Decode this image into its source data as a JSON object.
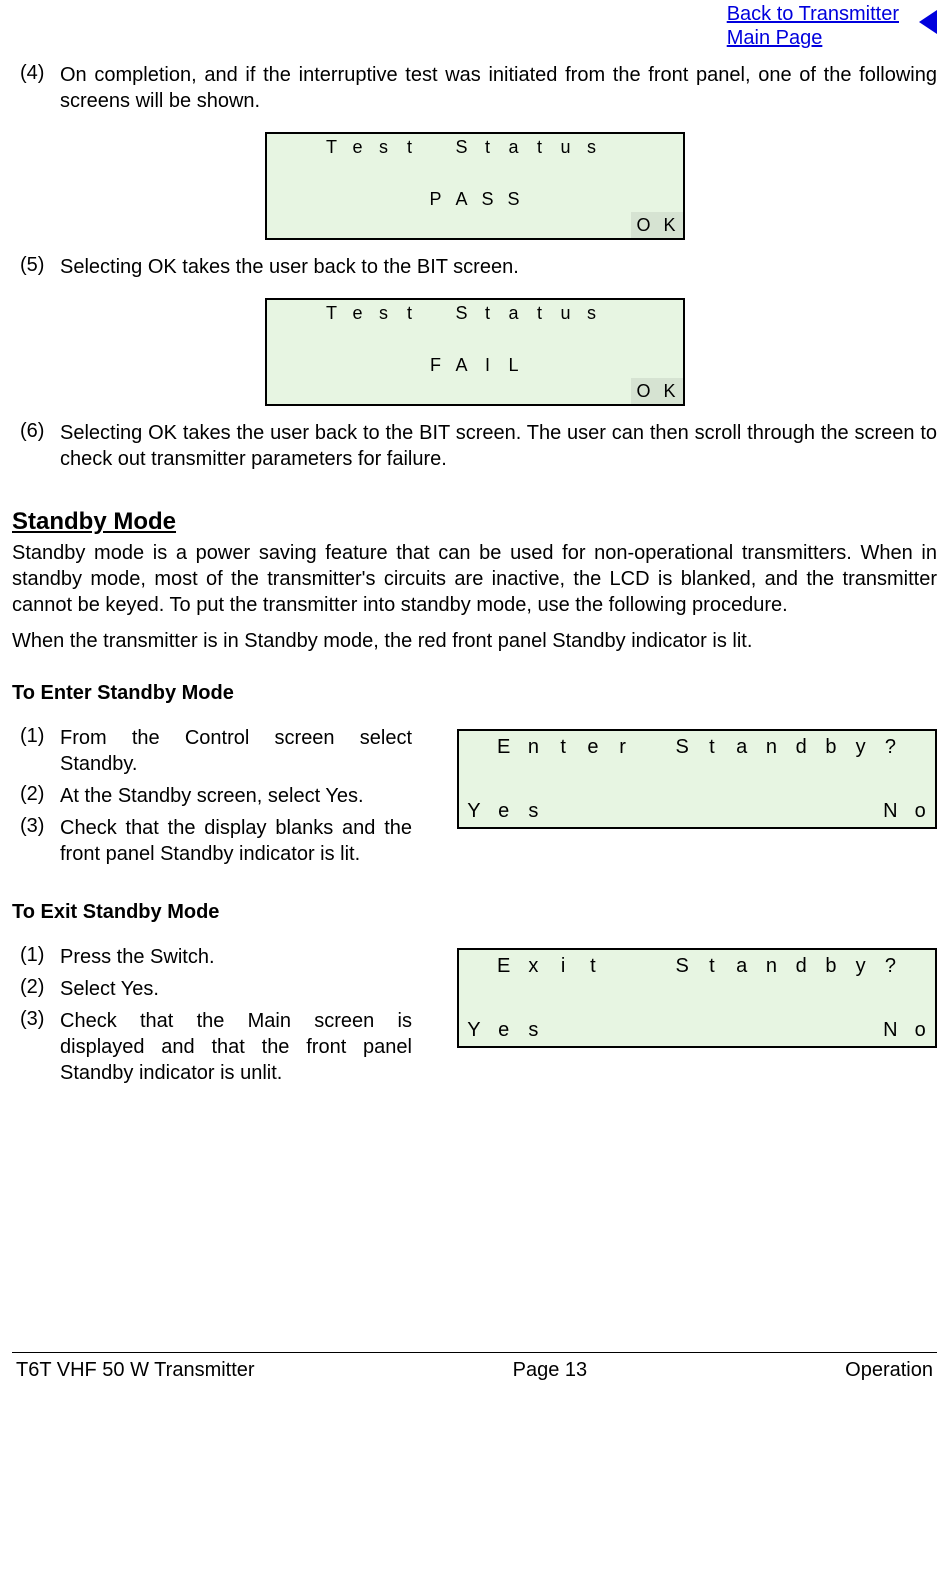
{
  "nav": {
    "back_link": "Back to Transmitter\nMain Page"
  },
  "steps_top": [
    {
      "num": "(4)",
      "text": "On completion, and if the interruptive test was initiated from the front panel, one of the following screens will be shown."
    },
    {
      "num": "(5)",
      "text": "Selecting OK takes the user back to the BIT screen."
    },
    {
      "num": "(6)",
      "text": "Selecting OK takes the user back to the BIT screen. The user can then scroll through the screen to check out transmitter parameters for failure."
    }
  ],
  "lcd_pass": {
    "r1": [
      "",
      "",
      "T",
      "e",
      "s",
      "t",
      "",
      "S",
      "t",
      "a",
      "t",
      "u",
      "s",
      "",
      "",
      ""
    ],
    "r2": [
      "",
      "",
      "",
      "",
      "",
      "",
      "",
      "",
      "",
      "",
      "",
      "",
      "",
      "",
      "",
      ""
    ],
    "r3": [
      "",
      "",
      "",
      "",
      "",
      "",
      "P",
      "A",
      "S",
      "S",
      "",
      "",
      "",
      "",
      "",
      ""
    ],
    "r4": [
      "",
      "",
      "",
      "",
      "",
      "",
      "",
      "",
      "",
      "",
      "",
      "",
      "",
      "",
      "O",
      "K"
    ],
    "hl": [
      14,
      15
    ]
  },
  "lcd_fail": {
    "r1": [
      "",
      "",
      "T",
      "e",
      "s",
      "t",
      "",
      "S",
      "t",
      "a",
      "t",
      "u",
      "s",
      "",
      "",
      ""
    ],
    "r2": [
      "",
      "",
      "",
      "",
      "",
      "",
      "",
      "",
      "",
      "",
      "",
      "",
      "",
      "",
      "",
      ""
    ],
    "r3": [
      "",
      "",
      "",
      "",
      "",
      "",
      "F",
      "A",
      "I",
      "L",
      "",
      "",
      "",
      "",
      "",
      ""
    ],
    "r4": [
      "",
      "",
      "",
      "",
      "",
      "",
      "",
      "",
      "",
      "",
      "",
      "",
      "",
      "",
      "O",
      "K"
    ],
    "hl": [
      14,
      15
    ]
  },
  "standby": {
    "heading": "Standby Mode",
    "para1": "Standby mode is a power saving feature that can be used for non-operational transmitters. When in standby mode, most of the transmitter's circuits are inactive, the LCD is blanked, and the transmitter cannot be keyed. To put the transmitter into standby mode, use the following procedure.",
    "para2": "When the transmitter is in Standby mode, the red front panel Standby indicator is lit."
  },
  "enter_standby": {
    "heading": "To Enter Standby Mode",
    "steps": [
      {
        "num": "(1)",
        "text": "From the Control screen select Standby."
      },
      {
        "num": "(2)",
        "text": "At the Standby screen, select Yes."
      },
      {
        "num": "(3)",
        "text": "Check that the display blanks and the front panel Standby indicator is lit."
      }
    ],
    "lcd": {
      "r1": [
        "",
        "E",
        "n",
        "t",
        "e",
        "r",
        "",
        "S",
        "t",
        "a",
        "n",
        "d",
        "b",
        "y",
        "?",
        ""
      ],
      "r2": [
        "",
        "",
        "",
        "",
        "",
        "",
        "",
        "",
        "",
        "",
        "",
        "",
        "",
        "",
        "",
        ""
      ],
      "r3": [
        "Y",
        "e",
        "s",
        "",
        "",
        "",
        "",
        "",
        "",
        "",
        "",
        "",
        "",
        "",
        "N",
        "o"
      ],
      "hl": [
        0
      ]
    }
  },
  "exit_standby": {
    "heading": "To Exit Standby Mode",
    "steps": [
      {
        "num": "(1)",
        "text": "Press the Switch."
      },
      {
        "num": "(2)",
        "text": "Select Yes."
      },
      {
        "num": "(3)",
        "text": "Check that the Main screen is displayed and that the front panel Standby indicator is unlit."
      }
    ],
    "lcd": {
      "r1": [
        "",
        "E",
        "x",
        "i",
        "t",
        "",
        "",
        "S",
        "t",
        "a",
        "n",
        "d",
        "b",
        "y",
        "?",
        ""
      ],
      "r2": [
        "",
        "",
        "",
        "",
        "",
        "",
        "",
        "",
        "",
        "",
        "",
        "",
        "",
        "",
        "",
        ""
      ],
      "r3": [
        "Y",
        "e",
        "s",
        "",
        "",
        "",
        "",
        "",
        "",
        "",
        "",
        "",
        "",
        "",
        "N",
        "o"
      ],
      "hl": [
        0
      ]
    }
  },
  "footer": {
    "left": "T6T VHF 50 W Transmitter",
    "center": "Page 13",
    "right": "Operation"
  }
}
